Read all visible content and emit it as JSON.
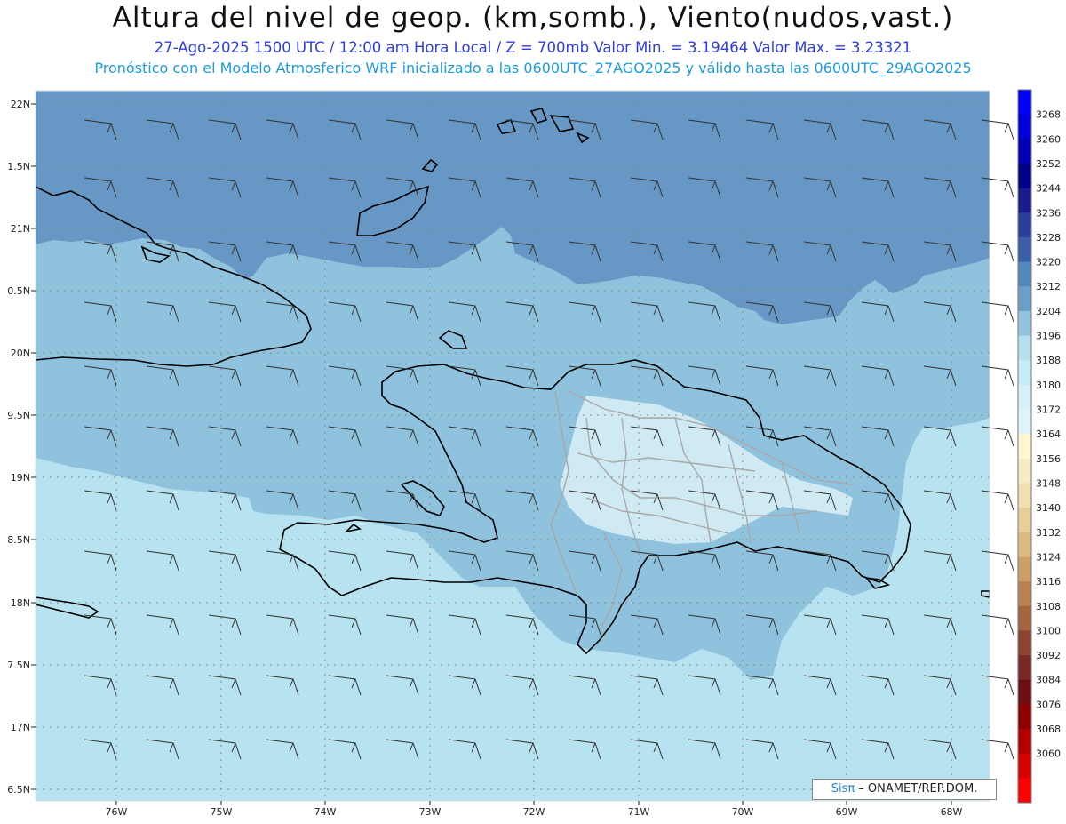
{
  "title": "Altura del nivel de geop. (km,somb.), Viento(nudos,vast.)",
  "subtitle_line1": "27-Ago-2025  1500 UTC / 12:00 am Hora Local / Z = 700mb    Valor Min. = 3.19464  Valor Max. = 3.23321",
  "subtitle_line2": "Pronóstico con el Modelo Atmosferico WRF inicializado a las 0600UTC_27AGO2025 y válido hasta las  0600UTC_29AGO2025",
  "lat_labels": [
    "22N",
    "1.5N",
    "21N",
    "0.5N",
    "20N",
    "9.5N",
    "19N",
    "8.5N",
    "18N",
    "7.5N",
    "17N",
    "6.5N"
  ],
  "lon_labels": [
    "76W",
    "75W",
    "74W",
    "73W",
    "72W",
    "71W",
    "70W",
    "69W",
    "68W"
  ],
  "colorbar": {
    "labels": [
      "3268",
      "3260",
      "3252",
      "3244",
      "3236",
      "3228",
      "3220",
      "3212",
      "3204",
      "3196",
      "3188",
      "3180",
      "3172",
      "3164",
      "3156",
      "3148",
      "3140",
      "3132",
      "3124",
      "3116",
      "3108",
      "3100",
      "3092",
      "3084",
      "3076",
      "3068",
      "3060"
    ],
    "colors": [
      "#0000ff",
      "#0000d8",
      "#0000b0",
      "#000088",
      "#1a1a8c",
      "#2a3f9a",
      "#3c5ea8",
      "#5488bb",
      "#6e9fc9",
      "#92c4de",
      "#b6e0ee",
      "#c6ebf4",
      "#d6f1f8",
      "#dff5fb",
      "#fff6d2",
      "#f6ecc6",
      "#efe0b2",
      "#e7cf9a",
      "#dcbb82",
      "#cda06a",
      "#b88352",
      "#a36440",
      "#8a4430",
      "#7a2a26",
      "#6e0f14",
      "#8c0000",
      "#b00000",
      "#d60000",
      "#ff0000"
    ]
  },
  "credit": {
    "sis": "Sisπ",
    "text": " – ONAMET/REP.DOM."
  }
}
